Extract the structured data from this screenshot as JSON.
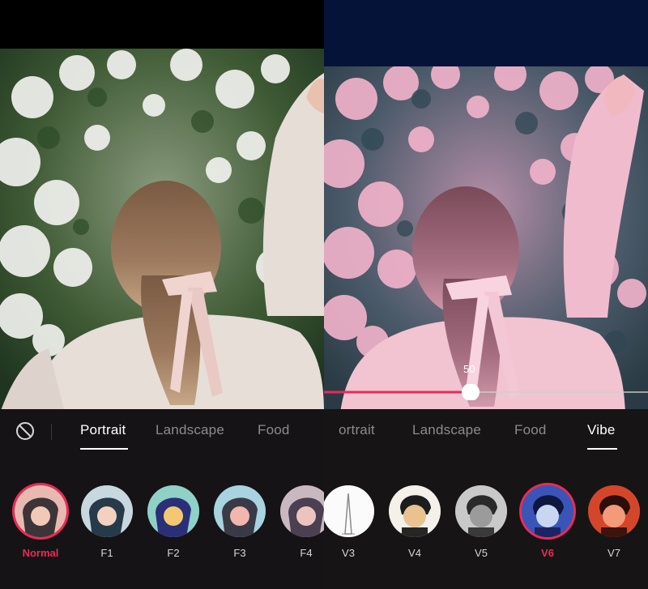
{
  "left": {
    "tabs": [
      {
        "label": "Portrait",
        "active": true
      },
      {
        "label": "Landscape",
        "active": false
      },
      {
        "label": "Food",
        "active": false
      }
    ],
    "filters": [
      {
        "label": "Normal",
        "selected": true
      },
      {
        "label": "F1",
        "selected": false
      },
      {
        "label": "F2",
        "selected": false
      },
      {
        "label": "F3",
        "selected": false
      },
      {
        "label": "F4",
        "selected": false
      }
    ]
  },
  "right": {
    "tabs": [
      {
        "label": "ortrait",
        "active": false
      },
      {
        "label": "Landscape",
        "active": false
      },
      {
        "label": "Food",
        "active": false
      },
      {
        "label": "Vibe",
        "active": true
      }
    ],
    "filters": [
      {
        "label": "V3",
        "selected": false
      },
      {
        "label": "V4",
        "selected": false
      },
      {
        "label": "V5",
        "selected": false
      },
      {
        "label": "V6",
        "selected": true
      },
      {
        "label": "V7",
        "selected": false
      }
    ],
    "slider": {
      "value": 50,
      "min": 0,
      "max": 100,
      "value_label": "50"
    }
  },
  "icons": {
    "none_filter": "prohibited-circle-icon"
  },
  "colors": {
    "accent": "#ea2b55",
    "panel": "#151316",
    "slider_active": "#ea2b55"
  }
}
